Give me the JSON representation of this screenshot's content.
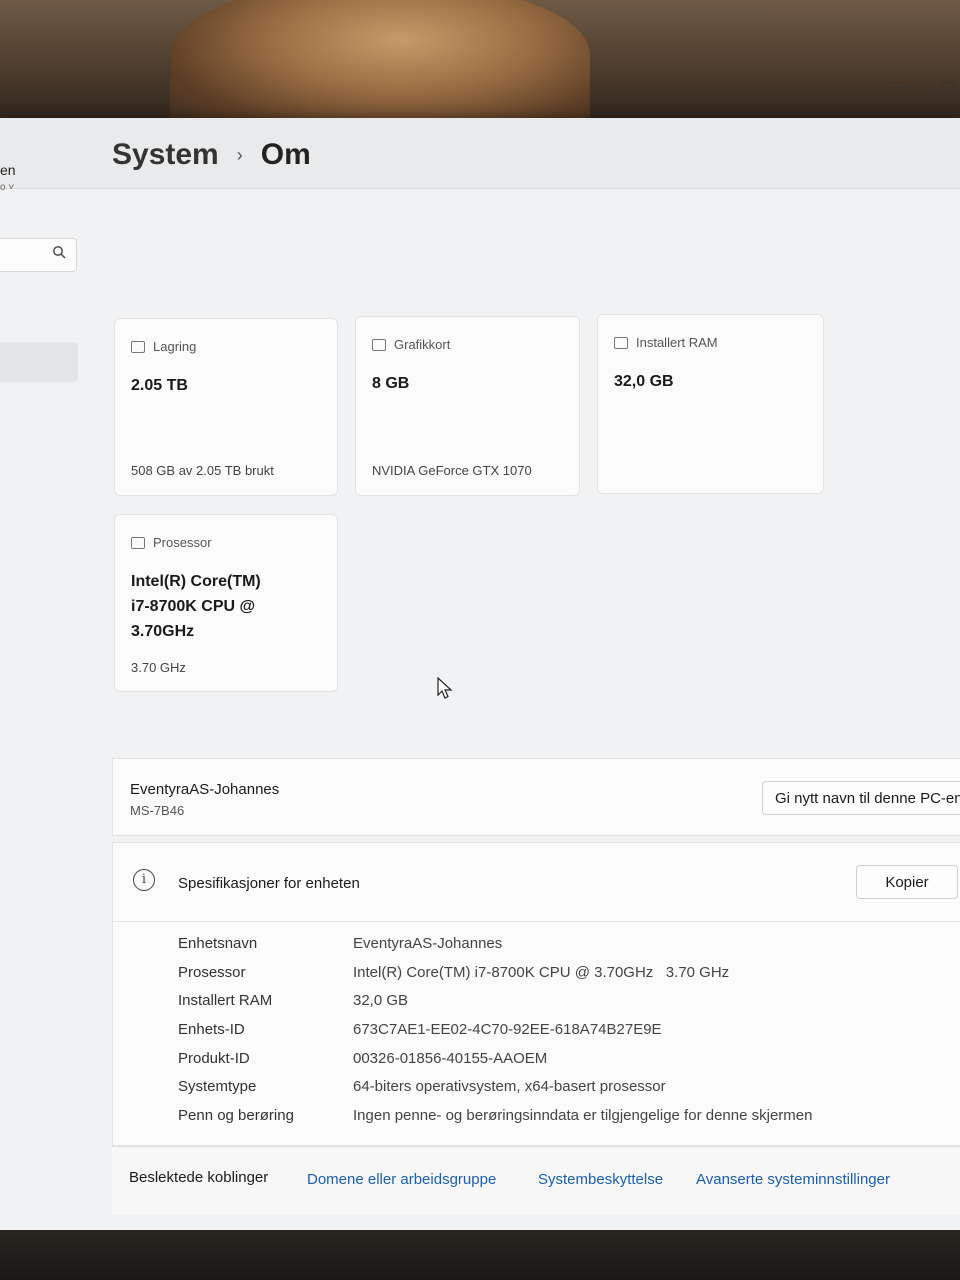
{
  "nav": {
    "fragment_text": "en",
    "fragment_sub": "o ˅",
    "search_icon": "search-icon"
  },
  "breadcrumb": {
    "parent": "System",
    "separator": "›",
    "current": "Om"
  },
  "cards": {
    "storage": {
      "label": "Lagring",
      "value": "2.05 TB",
      "sub": "508 GB av 2.05 TB brukt",
      "icon": "storage-icon"
    },
    "gpu": {
      "label": "Grafikkort",
      "value": "8 GB",
      "sub": "NVIDIA GeForce GTX 1070",
      "icon": "gpu-icon"
    },
    "ram": {
      "label": "Installert RAM",
      "value": "32,0 GB",
      "icon": "ram-icon"
    },
    "cpu": {
      "label": "Prosessor",
      "value_lines": [
        "Intel(R) Core(TM)",
        "i7-8700K CPU @",
        "3.70GHz"
      ],
      "sub": "3.70 GHz",
      "icon": "cpu-icon"
    }
  },
  "device": {
    "name": "EventyraAS-Johannes",
    "model": "MS-7B46",
    "rename_button": "Gi nytt navn til denne PC-en"
  },
  "specs": {
    "title": "Spesifikasjoner for enheten",
    "copy_button": "Kopier",
    "rows": [
      {
        "key": "Enhetsnavn",
        "value": "EventyraAS-Johannes"
      },
      {
        "key": "Prosessor",
        "value": "Intel(R) Core(TM) i7-8700K CPU @ 3.70GHz   3.70 GHz"
      },
      {
        "key": "Installert RAM",
        "value": "32,0 GB"
      },
      {
        "key": "Enhets-ID",
        "value": "673C7AE1-EE02-4C70-92EE-618A74B27E9E"
      },
      {
        "key": "Produkt-ID",
        "value": "00326-01856-40155-AAOEM"
      },
      {
        "key": "Systemtype",
        "value": "64-biters operativsystem, x64-basert prosessor"
      },
      {
        "key": "Penn og berøring",
        "value": "Ingen penne- og berøringsinndata er tilgjengelige for denne skjermen"
      }
    ]
  },
  "related": {
    "title": "Beslektede koblinger",
    "links": [
      "Domene eller arbeidsgruppe",
      "Systembeskyttelse",
      "Avanserte systeminnstillinger"
    ]
  },
  "colors": {
    "link": "#1a5fb4",
    "background": "#f1f2f3",
    "card": "#fbfbfb"
  }
}
